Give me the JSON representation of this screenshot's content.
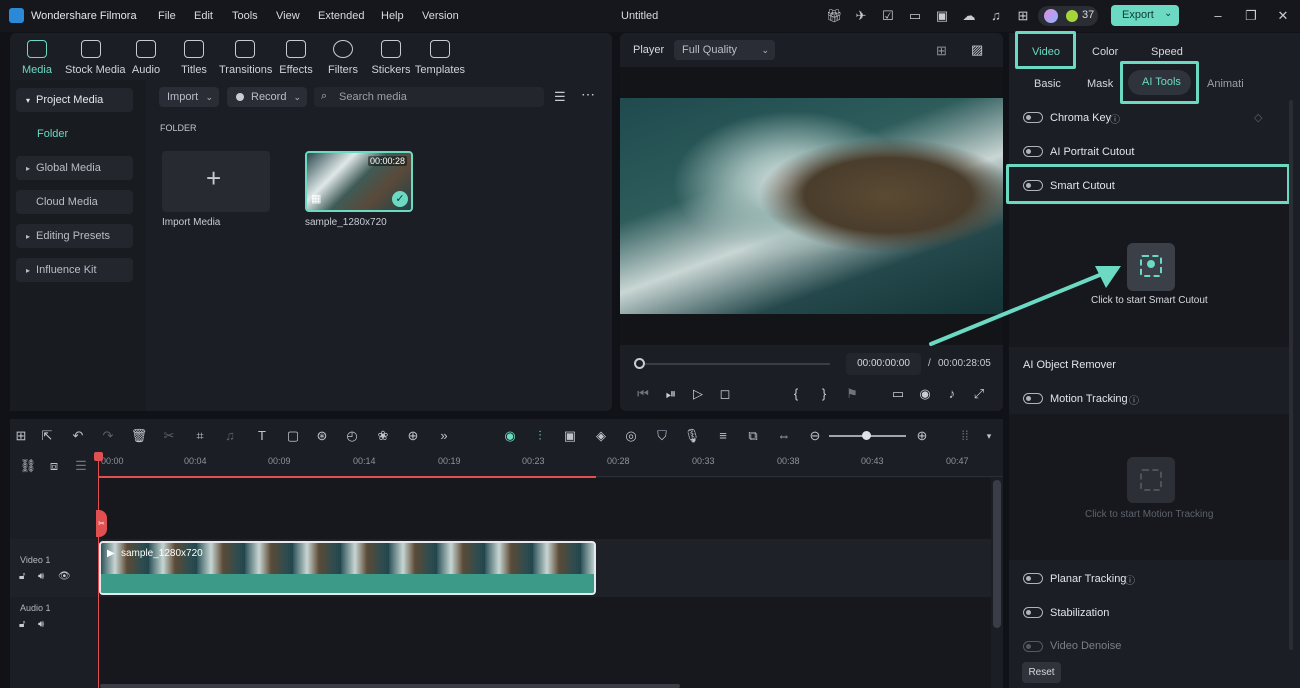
{
  "app": {
    "title": "Wondershare Filmora",
    "document": "Untitled",
    "menus": [
      "File",
      "Edit",
      "Tools",
      "View",
      "Extended",
      "Help",
      "Version"
    ],
    "credits": "37",
    "export_label": "Export",
    "accent": "#6cd9c3"
  },
  "media_tabs": [
    "Media",
    "Stock Media",
    "Audio",
    "Titles",
    "Transitions",
    "Effects",
    "Filters",
    "Stickers",
    "Templates"
  ],
  "sidebar": {
    "items": [
      "Project Media",
      "Folder",
      "Global Media",
      "Cloud Media",
      "Editing Presets",
      "Influence Kit"
    ]
  },
  "library": {
    "import_label": "Import",
    "record_label": "Record",
    "search_placeholder": "Search media",
    "folder_heading": "FOLDER",
    "import_media_label": "Import Media",
    "clip_name": "sample_1280x720",
    "clip_duration": "00:00:28"
  },
  "player": {
    "label": "Player",
    "quality": "Full Quality",
    "current_time": "00:00:00:00",
    "separator": "/",
    "total_time": "00:00:28:05"
  },
  "props": {
    "tabs": [
      "Video",
      "Color",
      "Speed"
    ],
    "subtabs": [
      "Basic",
      "Mask",
      "AI Tools",
      "Animati"
    ],
    "chroma_key": "Chroma Key",
    "ai_portrait": "AI Portrait Cutout",
    "smart_cutout": "Smart Cutout",
    "smart_cutout_hint": "Click to start Smart Cutout",
    "ai_object_remover": "AI Object Remover",
    "motion_tracking": "Motion Tracking",
    "motion_tracking_hint": "Click to start Motion Tracking",
    "planar_tracking": "Planar Tracking",
    "stabilization": "Stabilization",
    "video_denoise": "Video Denoise",
    "reset": "Reset"
  },
  "timeline": {
    "ruler": [
      "00:00",
      "00:04",
      "00:09",
      "00:14",
      "00:19",
      "00:23",
      "00:28",
      "00:33",
      "00:38",
      "00:43",
      "00:47"
    ],
    "video_track": "Video 1",
    "audio_track": "Audio 1",
    "clip_name": "sample_1280x720"
  }
}
